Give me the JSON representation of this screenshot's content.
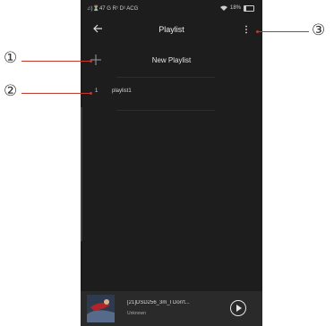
{
  "status": {
    "left": "♫)⏳47 G R¹ D¹ ACG",
    "battery": "18%",
    "battery_level": 0.18
  },
  "header": {
    "title": "Playlist"
  },
  "new_playlist": {
    "label": "New Playlist"
  },
  "playlists": [
    {
      "index": "1",
      "name": "playlist1"
    }
  ],
  "player": {
    "title": "[21]DSD256_3m_I Don't...",
    "artist": "Unknown"
  },
  "callouts": [
    "①",
    "②",
    "③"
  ],
  "colors": {
    "background": "#1d1d1d",
    "callout_line": "#c0392b"
  }
}
